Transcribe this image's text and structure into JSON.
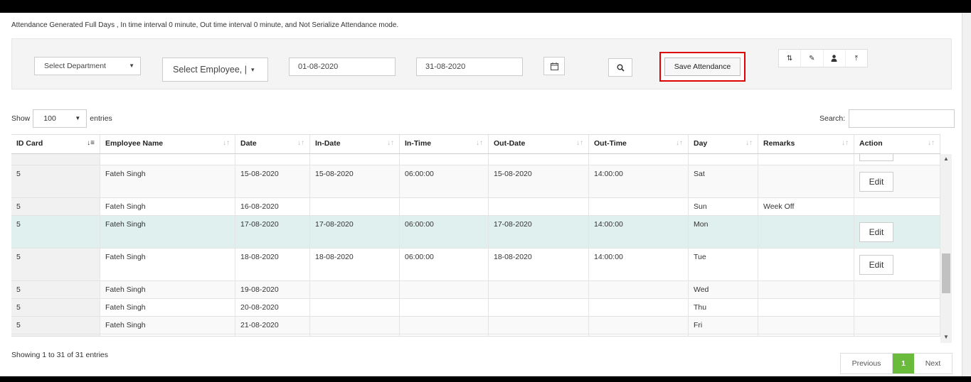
{
  "notice": "Attendance Generated Full Days , In time interval 0 minute, Out time interval 0 minute, and Not Serialize Attendance mode.",
  "filters": {
    "department": "Select Department",
    "employee": "Select Employee, |",
    "date_from": "01-08-2020",
    "date_to": "31-08-2020",
    "save_label": "Save Attendance"
  },
  "icons": {
    "caret": "▼",
    "emp_caret": "▾",
    "calendar": "📅",
    "search": "🔍",
    "sort_arrows": "⇅",
    "edit": "✎",
    "user": "👤",
    "upload": "⤒",
    "sort_both": "↓↑",
    "sort_active": "↓≡",
    "scroll_up": "▲",
    "scroll_down": "▼"
  },
  "length": {
    "show": "Show",
    "value": "100",
    "entries": "entries"
  },
  "search": {
    "label": "Search:"
  },
  "columns": [
    "ID Card",
    "Employee Name",
    "Date",
    "In-Date",
    "In-Time",
    "Out-Date",
    "Out-Time",
    "Day",
    "Remarks",
    "Action"
  ],
  "edit_label": "Edit",
  "rows": [
    {
      "id": "",
      "name": "",
      "date": "",
      "in_date": "",
      "in_time": "",
      "out_date": "",
      "out_time": "",
      "day": "",
      "remarks": "",
      "edit": true,
      "style": "partial"
    },
    {
      "id": "5",
      "name": "Fateh Singh",
      "date": "15-08-2020",
      "in_date": "15-08-2020",
      "in_time": "06:00:00",
      "out_date": "15-08-2020",
      "out_time": "14:00:00",
      "day": "Sat",
      "remarks": "",
      "edit": true,
      "style": "alt"
    },
    {
      "id": "5",
      "name": "Fateh Singh",
      "date": "16-08-2020",
      "in_date": "",
      "in_time": "",
      "out_date": "",
      "out_time": "",
      "day": "Sun",
      "remarks": "Week Off",
      "edit": false,
      "style": ""
    },
    {
      "id": "5",
      "name": "Fateh Singh",
      "date": "17-08-2020",
      "in_date": "17-08-2020",
      "in_time": "06:00:00",
      "out_date": "17-08-2020",
      "out_time": "14:00:00",
      "day": "Mon",
      "remarks": "",
      "edit": true,
      "style": "hl"
    },
    {
      "id": "5",
      "name": "Fateh Singh",
      "date": "18-08-2020",
      "in_date": "18-08-2020",
      "in_time": "06:00:00",
      "out_date": "18-08-2020",
      "out_time": "14:00:00",
      "day": "Tue",
      "remarks": "",
      "edit": true,
      "style": ""
    },
    {
      "id": "5",
      "name": "Fateh Singh",
      "date": "19-08-2020",
      "in_date": "",
      "in_time": "",
      "out_date": "",
      "out_time": "",
      "day": "Wed",
      "remarks": "",
      "edit": false,
      "style": "alt"
    },
    {
      "id": "5",
      "name": "Fateh Singh",
      "date": "20-08-2020",
      "in_date": "",
      "in_time": "",
      "out_date": "",
      "out_time": "",
      "day": "Thu",
      "remarks": "",
      "edit": false,
      "style": ""
    },
    {
      "id": "5",
      "name": "Fateh Singh",
      "date": "21-08-2020",
      "in_date": "",
      "in_time": "",
      "out_date": "",
      "out_time": "",
      "day": "Fri",
      "remarks": "",
      "edit": false,
      "style": "alt"
    },
    {
      "id": "",
      "name": "",
      "date": "",
      "in_date": "",
      "in_time": "",
      "out_date": "",
      "out_time": "",
      "day": "",
      "remarks": "",
      "edit": false,
      "style": ""
    }
  ],
  "footer": {
    "info": "Showing 1 to 31 of 31 entries",
    "previous": "Previous",
    "current_page": "1",
    "next": "Next"
  },
  "colors": {
    "accent_green": "#6aba3c",
    "highlight_row": "#dff0ee",
    "save_outline": "#e00000"
  }
}
